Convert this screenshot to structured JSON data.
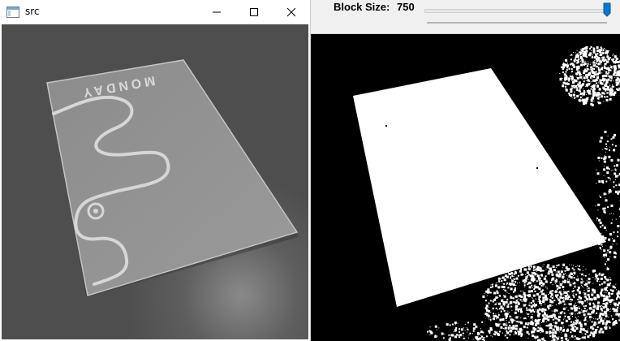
{
  "left_window": {
    "title": "src",
    "icon": "app-window-icon",
    "controls": [
      "minimize-icon",
      "maximize-icon",
      "close-icon"
    ],
    "card_text": "MONDAY"
  },
  "right_window": {
    "trackbar": {
      "label": "Block Size:",
      "value": "750",
      "level": 0.99,
      "accent": "#0078d7"
    }
  }
}
